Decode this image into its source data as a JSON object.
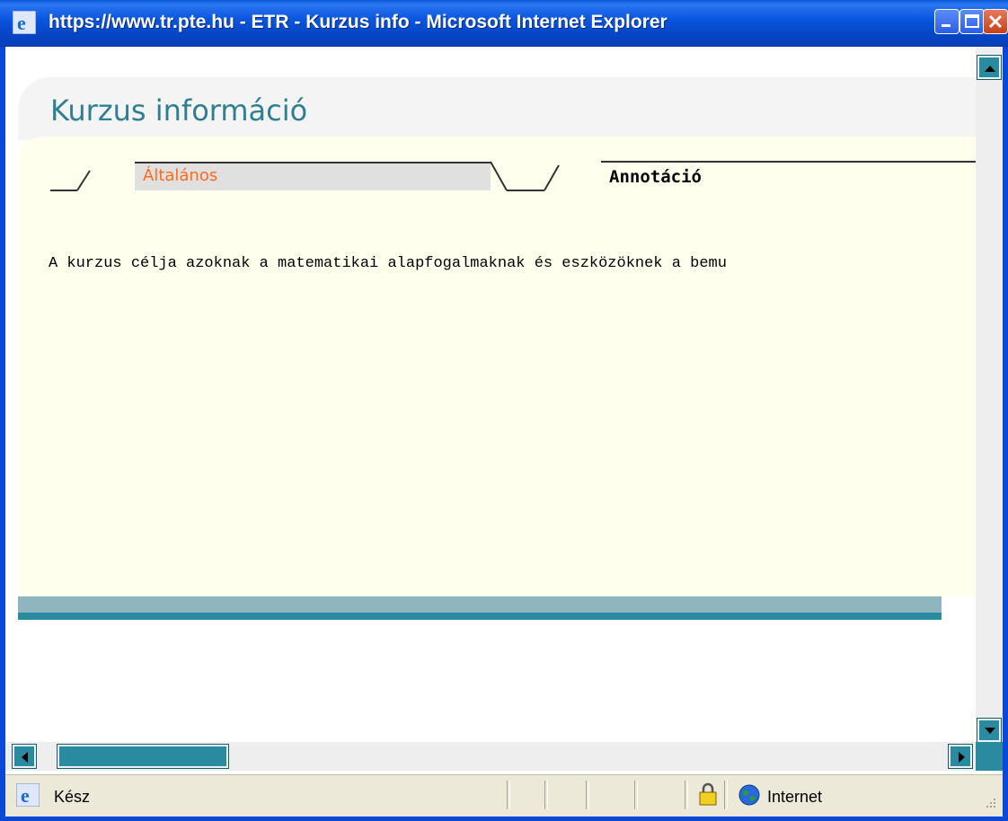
{
  "window": {
    "title": "https://www.tr.pte.hu - ETR - Kurzus info - Microsoft Internet Explorer",
    "app_icon": "ie-icon",
    "controls": [
      "minimize-icon",
      "maximize-icon",
      "close-icon"
    ]
  },
  "page": {
    "title": "Kurzus információ"
  },
  "tabs": [
    {
      "label": "Általános",
      "active": false
    },
    {
      "label": "Annotáció",
      "active": true
    }
  ],
  "annotation": {
    "text": "A kurzus célja azoknak a matematikai alapfogalmaknak és eszközöknek a bemu"
  },
  "statusbar": {
    "status": "Kész",
    "zone": "Internet",
    "icons": [
      "ie-icon",
      "lock-icon",
      "globe-icon",
      "resize-grip-icon"
    ]
  },
  "colors": {
    "title_bar": "#0a5ad8",
    "page_title": "#2f7f90",
    "inactive_tab_text": "#ff6a1a",
    "content_bg": "#ffffee",
    "scrollbar": "#2a8aa0"
  }
}
